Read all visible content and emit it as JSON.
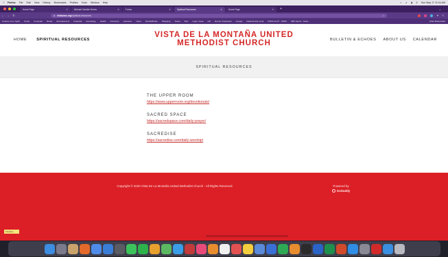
{
  "menubar": {
    "app": "Firefox",
    "items": [
      "File",
      "Edit",
      "View",
      "History",
      "Bookmarks",
      "Profiles",
      "Tools",
      "Window",
      "Help"
    ],
    "clock": "Sun May 17 11:04 AM"
  },
  "tabs": [
    {
      "label": "Home Page",
      "active": false
    },
    {
      "label": "Michael Gamble Nelms",
      "active": false
    },
    {
      "label": "Forms",
      "active": false
    },
    {
      "label": "Spiritual Resources",
      "active": true
    },
    {
      "label": "Home Page",
      "active": false
    }
  ],
  "url": {
    "domain": "vistaumc.org",
    "path": "/spiritual-resources"
  },
  "bookmarks": [
    "Amazon.com: Spirit",
    "Cards",
    "Computer",
    "Books",
    "Entertainment",
    "Financial",
    "Genealogy",
    "Health",
    "Insurance",
    "Literature",
    "News",
    "DoubleBooks",
    "Shopping",
    "Travel",
    "FAA",
    "Login / Iowa",
    "HR",
    "Events | Facebook",
    "Google",
    "National and Local",
    "USPS.com® - USPS",
    "SBS Sports - Nava..."
  ],
  "bookmarks_other": "Other Bookmarks",
  "site": {
    "title": "VISTA DE LA MONTAÑA UNITED METHODIST CHURCH",
    "nav_left": [
      {
        "label": "HOME",
        "current": false
      },
      {
        "label": "SPIRITUAL RESOURCES",
        "current": true
      }
    ],
    "nav_right": [
      "BULLETIN & ECHOES",
      "ABOUT US",
      "CALENDAR"
    ]
  },
  "banner": "SPIRITUAL RESOURCES",
  "resources": [
    {
      "title": "THE UPPER ROOM",
      "link": "https://www.upperroom.org/devotionals/"
    },
    {
      "title": "SACRED SPACE",
      "link": "https://sacredspace.com/daily-prayer/"
    },
    {
      "title": "SACREDISE",
      "link": "https://sacredise.com/daily-worship/"
    }
  ],
  "footer": {
    "copyright": "Copyright © 2020 Vista De La Montaña United Methodist Church - All Rights Reserved.",
    "powered_by": "Powered by",
    "brand": "GoDaddy"
  },
  "toast": "Timeline",
  "dock_icons": [
    {
      "name": "finder-icon",
      "color": "#3d8de0"
    },
    {
      "name": "launchpad-icon",
      "color": "#7a7a8c"
    },
    {
      "name": "contacts-icon",
      "color": "#c9a36b"
    },
    {
      "name": "firefox-icon",
      "color": "#e46a2b"
    },
    {
      "name": "chrome-icon",
      "color": "#4f8be8"
    },
    {
      "name": "mail-icon",
      "color": "#3a7dd6"
    },
    {
      "name": "calculator-icon",
      "color": "#5b5b63"
    },
    {
      "name": "messages-icon",
      "color": "#3cc25a"
    },
    {
      "name": "facetime-icon",
      "color": "#2eb24c"
    },
    {
      "name": "photos-icon",
      "color": "#e8a02f"
    },
    {
      "name": "maps-icon",
      "color": "#5cb860"
    },
    {
      "name": "safari-icon",
      "color": "#3b9de6"
    },
    {
      "name": "photobooth-icon",
      "color": "#c23a3a"
    },
    {
      "name": "itunes-icon",
      "color": "#e84b7a"
    },
    {
      "name": "books-icon",
      "color": "#e88d2f"
    },
    {
      "name": "calendar-icon",
      "color": "#f0f0f0"
    },
    {
      "name": "reminders-icon",
      "color": "#e45151"
    },
    {
      "name": "notes-icon",
      "color": "#f3cd3f"
    },
    {
      "name": "preview-icon",
      "color": "#5a8ad8"
    },
    {
      "name": "keynote-icon",
      "color": "#3a6fd6"
    },
    {
      "name": "numbers-icon",
      "color": "#2eaa55"
    },
    {
      "name": "pages-icon",
      "color": "#e88d2f"
    },
    {
      "name": "terminal-icon",
      "color": "#2b2b2b"
    },
    {
      "name": "word-icon",
      "color": "#2b63c6"
    },
    {
      "name": "excel-icon",
      "color": "#1f8f4d"
    },
    {
      "name": "powerpoint-icon",
      "color": "#d24a2b"
    },
    {
      "name": "appstore-icon",
      "color": "#2f8de6"
    },
    {
      "name": "settings-icon",
      "color": "#8a8a96"
    },
    {
      "name": "acrobat-icon",
      "color": "#d22a2a"
    },
    {
      "name": "folder-icon",
      "color": "#3a8fe0"
    },
    {
      "name": "trash-icon",
      "color": "#b9b9c2"
    }
  ]
}
